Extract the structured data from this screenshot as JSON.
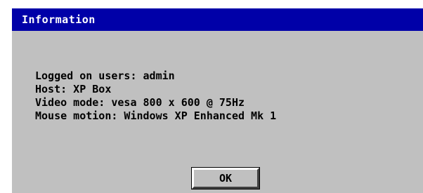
{
  "window": {
    "title": "Information"
  },
  "info": {
    "logged_on_users": "Logged on users: admin",
    "host": "Host: XP Box",
    "video_mode": "Video mode: vesa 800 x 600 @ 75Hz",
    "mouse_motion": "Mouse motion: Windows XP Enhanced Mk 1"
  },
  "buttons": {
    "ok_label": "OK"
  },
  "colors": {
    "titlebar": "#0000a8",
    "dialog_background": "#c0c0c0",
    "title_text": "#ffffff"
  }
}
